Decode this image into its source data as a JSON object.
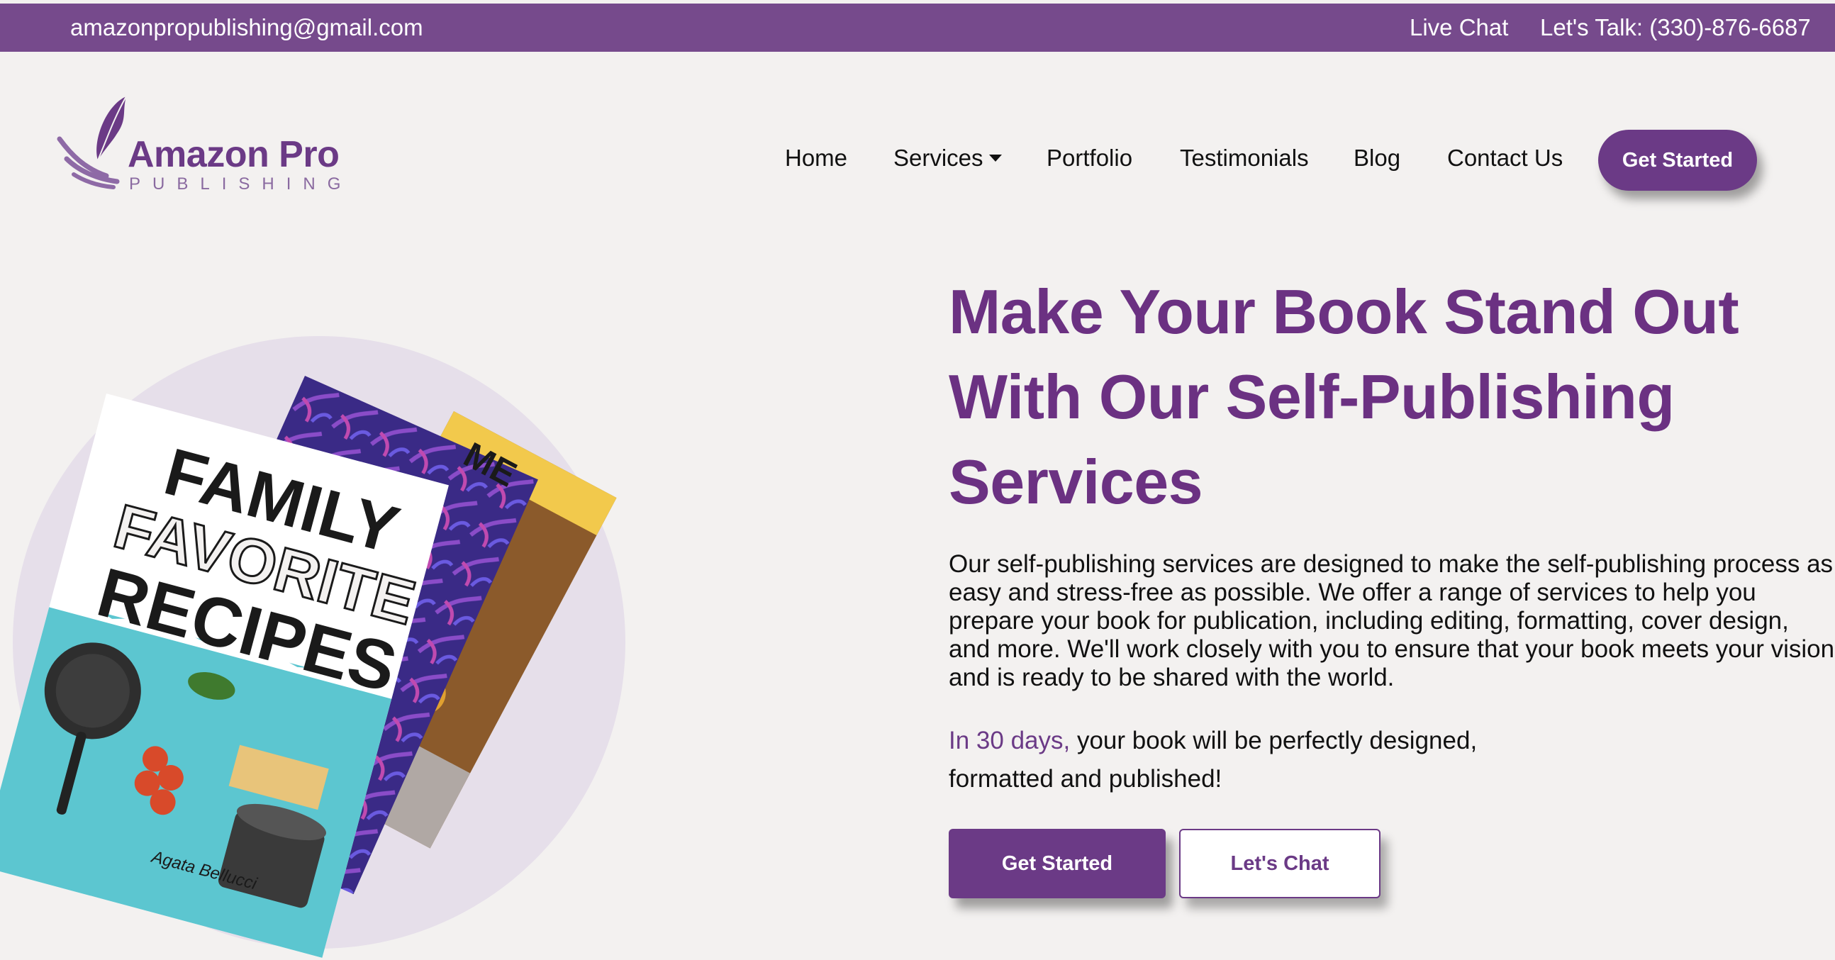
{
  "topbar": {
    "email": "amazonpropublishing@gmail.com",
    "live_chat": "Live Chat",
    "phone": "Let's Talk: (330)-876-6687"
  },
  "logo": {
    "brand": "Amazon Pro",
    "sub": "PUBLISHING",
    "icon": "feather-quill-icon"
  },
  "nav": {
    "items": [
      {
        "label": "Home"
      },
      {
        "label": "Services"
      },
      {
        "label": "Portfolio"
      },
      {
        "label": "Testimonials"
      },
      {
        "label": "Blog"
      },
      {
        "label": "Contact Us"
      }
    ],
    "cta": "Get Started"
  },
  "hero": {
    "headline": "Make Your Book Stand Out With Our Self-Publishing Services",
    "paragraph": "Our self-publishing services are designed to make the self-publishing process as easy and stress-free as possible. We offer a range of services to help you prepare your book for publication, including editing, formatting, cover design, and more. We'll work closely with you to ensure that your book meets your vision and is ready to be shared with the world.",
    "tagline_accent": "In 30 days,",
    "tagline_rest": "your book will be perfectly designed, formatted and published!",
    "primary_button": "Get Started",
    "secondary_button": "Let's Chat",
    "book": {
      "title_line1": "FAMILY",
      "title_line2": "FAVORITE",
      "title_line3": "RECIPES",
      "author": "Agata Bellucci",
      "back_cover_fragment": "ME"
    }
  },
  "colors": {
    "brand_purple": "#764a8c",
    "headline_purple": "#6b3182",
    "background": "#f3f1f0",
    "circle": "#e6dfea"
  }
}
